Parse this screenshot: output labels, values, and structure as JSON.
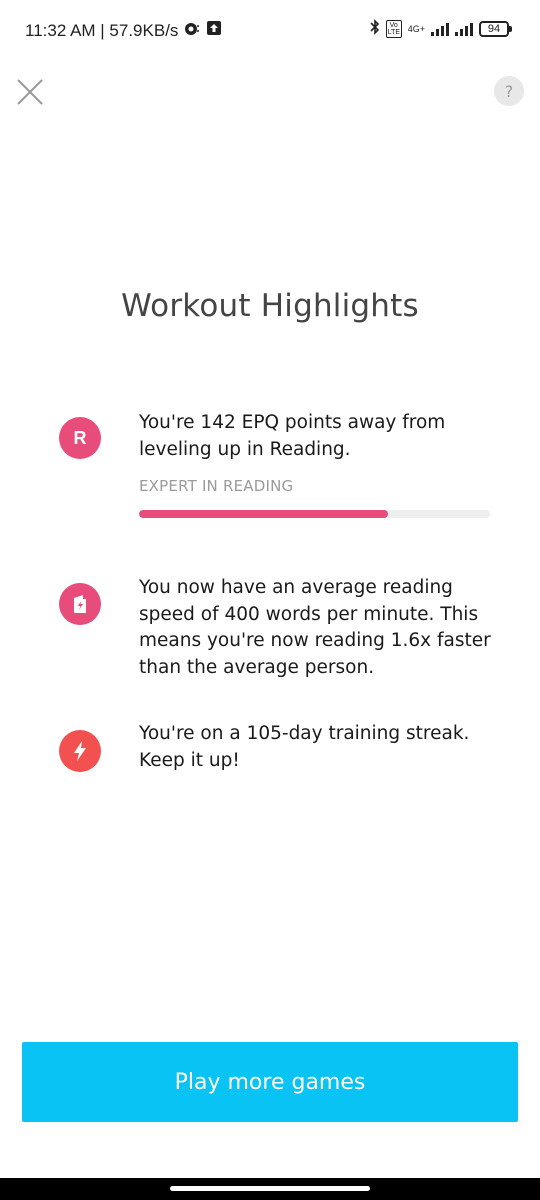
{
  "status_bar": {
    "time_speed": "11:32 AM | 57.9KB/s",
    "network_label": "4G+",
    "volte_label": "Vo LTE",
    "battery": "94"
  },
  "header": {
    "help_label": "?"
  },
  "title": "Workout Highlights",
  "highlights": {
    "reading": {
      "icon_letter": "R",
      "text": "You're 142 EPQ points away from leveling up in Reading.",
      "level_label": "EXPERT IN READING",
      "progress": 0.71
    },
    "speed": {
      "text": "You now have an average reading speed of 400 words per minute. This means you're now reading 1.6x faster than the average person."
    },
    "streak": {
      "text": "You're on a 105-day training streak. Keep it up!"
    }
  },
  "cta": {
    "label": "Play more games"
  },
  "colors": {
    "accent_pink": "#e84c7b",
    "accent_red": "#f25150",
    "button_blue": "#08c3f3"
  }
}
